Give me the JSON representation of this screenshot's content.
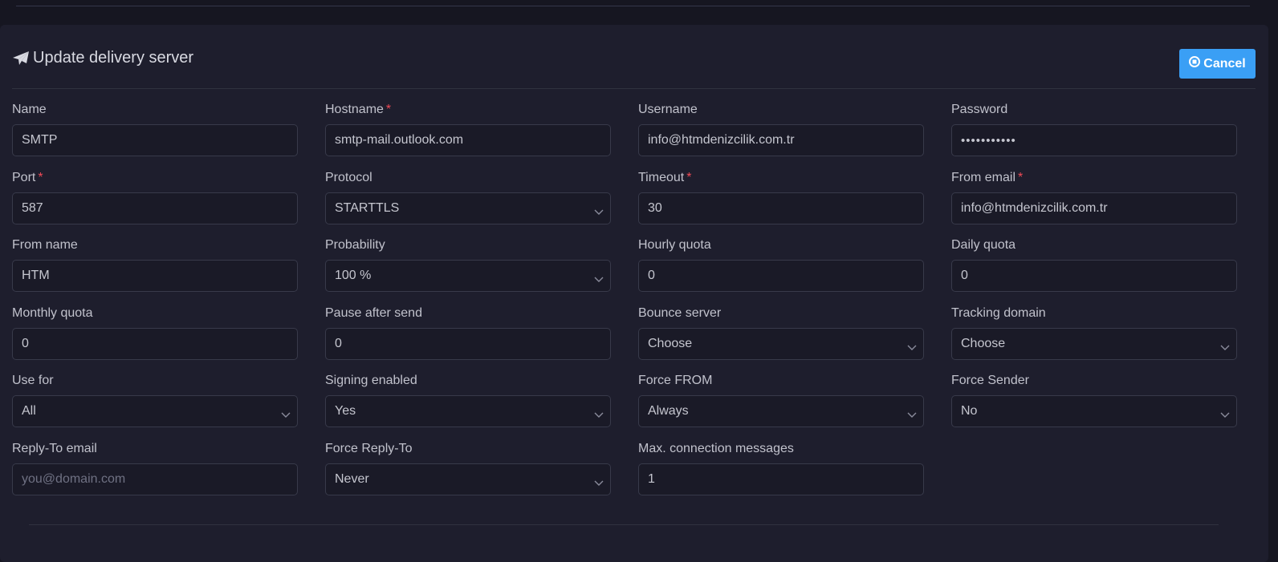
{
  "header": {
    "title": "Update delivery server",
    "title_icon": "paper-plane-icon",
    "cancel_label": "Cancel",
    "cancel_icon": "circle-stop-icon",
    "accent_color": "#3a9ff5"
  },
  "fields": [
    {
      "key": "name",
      "label": "Name",
      "required": false,
      "type": "input",
      "value": "SMTP"
    },
    {
      "key": "hostname",
      "label": "Hostname",
      "required": true,
      "type": "input",
      "value": "smtp-mail.outlook.com"
    },
    {
      "key": "username",
      "label": "Username",
      "required": false,
      "type": "input",
      "value": "info@htmdenizcilik.com.tr"
    },
    {
      "key": "password",
      "label": "Password",
      "required": false,
      "type": "password",
      "value": "•••••••••••"
    },
    {
      "key": "port",
      "label": "Port",
      "required": true,
      "type": "input",
      "value": "587"
    },
    {
      "key": "protocol",
      "label": "Protocol",
      "required": false,
      "type": "select",
      "value": "STARTTLS"
    },
    {
      "key": "timeout",
      "label": "Timeout",
      "required": true,
      "type": "input",
      "value": "30"
    },
    {
      "key": "from_email",
      "label": "From email",
      "required": true,
      "type": "input",
      "value": "info@htmdenizcilik.com.tr"
    },
    {
      "key": "from_name",
      "label": "From name",
      "required": false,
      "type": "input",
      "value": "HTM"
    },
    {
      "key": "probability",
      "label": "Probability",
      "required": false,
      "type": "select",
      "value": "100 %"
    },
    {
      "key": "hourly_quota",
      "label": "Hourly quota",
      "required": false,
      "type": "input",
      "value": "0"
    },
    {
      "key": "daily_quota",
      "label": "Daily quota",
      "required": false,
      "type": "input",
      "value": "0"
    },
    {
      "key": "monthly_quota",
      "label": "Monthly quota",
      "required": false,
      "type": "input",
      "value": "0"
    },
    {
      "key": "pause_after_send",
      "label": "Pause after send",
      "required": false,
      "type": "input",
      "value": "0"
    },
    {
      "key": "bounce_server",
      "label": "Bounce server",
      "required": false,
      "type": "select",
      "value": "Choose"
    },
    {
      "key": "tracking_domain",
      "label": "Tracking domain",
      "required": false,
      "type": "select",
      "value": "Choose"
    },
    {
      "key": "use_for",
      "label": "Use for",
      "required": false,
      "type": "select",
      "value": "All"
    },
    {
      "key": "signing_enabled",
      "label": "Signing enabled",
      "required": false,
      "type": "select",
      "value": "Yes"
    },
    {
      "key": "force_from",
      "label": "Force FROM",
      "required": false,
      "type": "select",
      "value": "Always"
    },
    {
      "key": "force_sender",
      "label": "Force Sender",
      "required": false,
      "type": "select",
      "value": "No"
    },
    {
      "key": "reply_to_email",
      "label": "Reply-To email",
      "required": false,
      "type": "input",
      "value": "",
      "placeholder": "you@domain.com"
    },
    {
      "key": "force_reply_to",
      "label": "Force Reply-To",
      "required": false,
      "type": "select",
      "value": "Never"
    },
    {
      "key": "max_connection_messages",
      "label": "Max. connection messages",
      "required": false,
      "type": "input",
      "value": "1"
    }
  ]
}
